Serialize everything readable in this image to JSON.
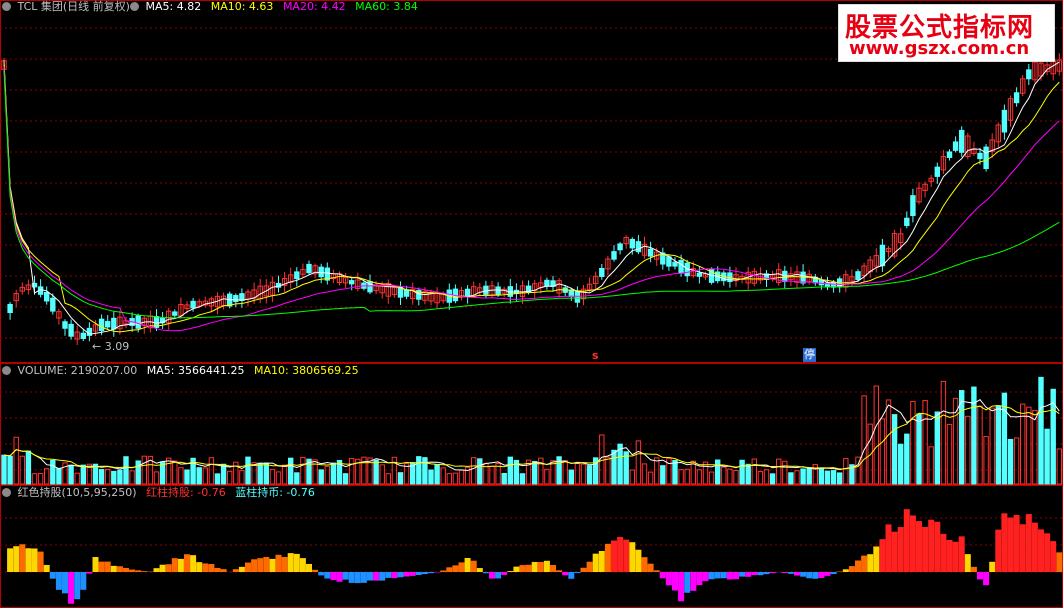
{
  "price_panel": {
    "stock": "TCL 集团(日线 前复权)",
    "ma5": "MA5: 4.82",
    "ma10": "MA10: 4.63",
    "ma20": "MA20: 4.42",
    "ma60": "MA60: 3.84",
    "low_marker": "3.09",
    "marker_s": "s",
    "marker_stop": "停"
  },
  "volume_panel": {
    "title": "VOLUME: 2190207.00",
    "ma5": "MA5: 3566441.25",
    "ma10": "MA10: 3806569.25"
  },
  "indicator_panel": {
    "title": "红色持股(10,5,95,250)",
    "red": "红柱持股: -0.76",
    "blue": "蓝柱持币: -0.76"
  },
  "watermark": {
    "line1": "股票公式指标网",
    "line2": "www.gszx.com.cn"
  },
  "colors": {
    "up": "#ff3232",
    "down": "#54ffff",
    "ma5": "#ffffff",
    "ma10": "#ffff00",
    "ma20": "#ff00ff",
    "ma60": "#00ff00",
    "grid": "#8b0000",
    "border": "#b40000"
  }
}
